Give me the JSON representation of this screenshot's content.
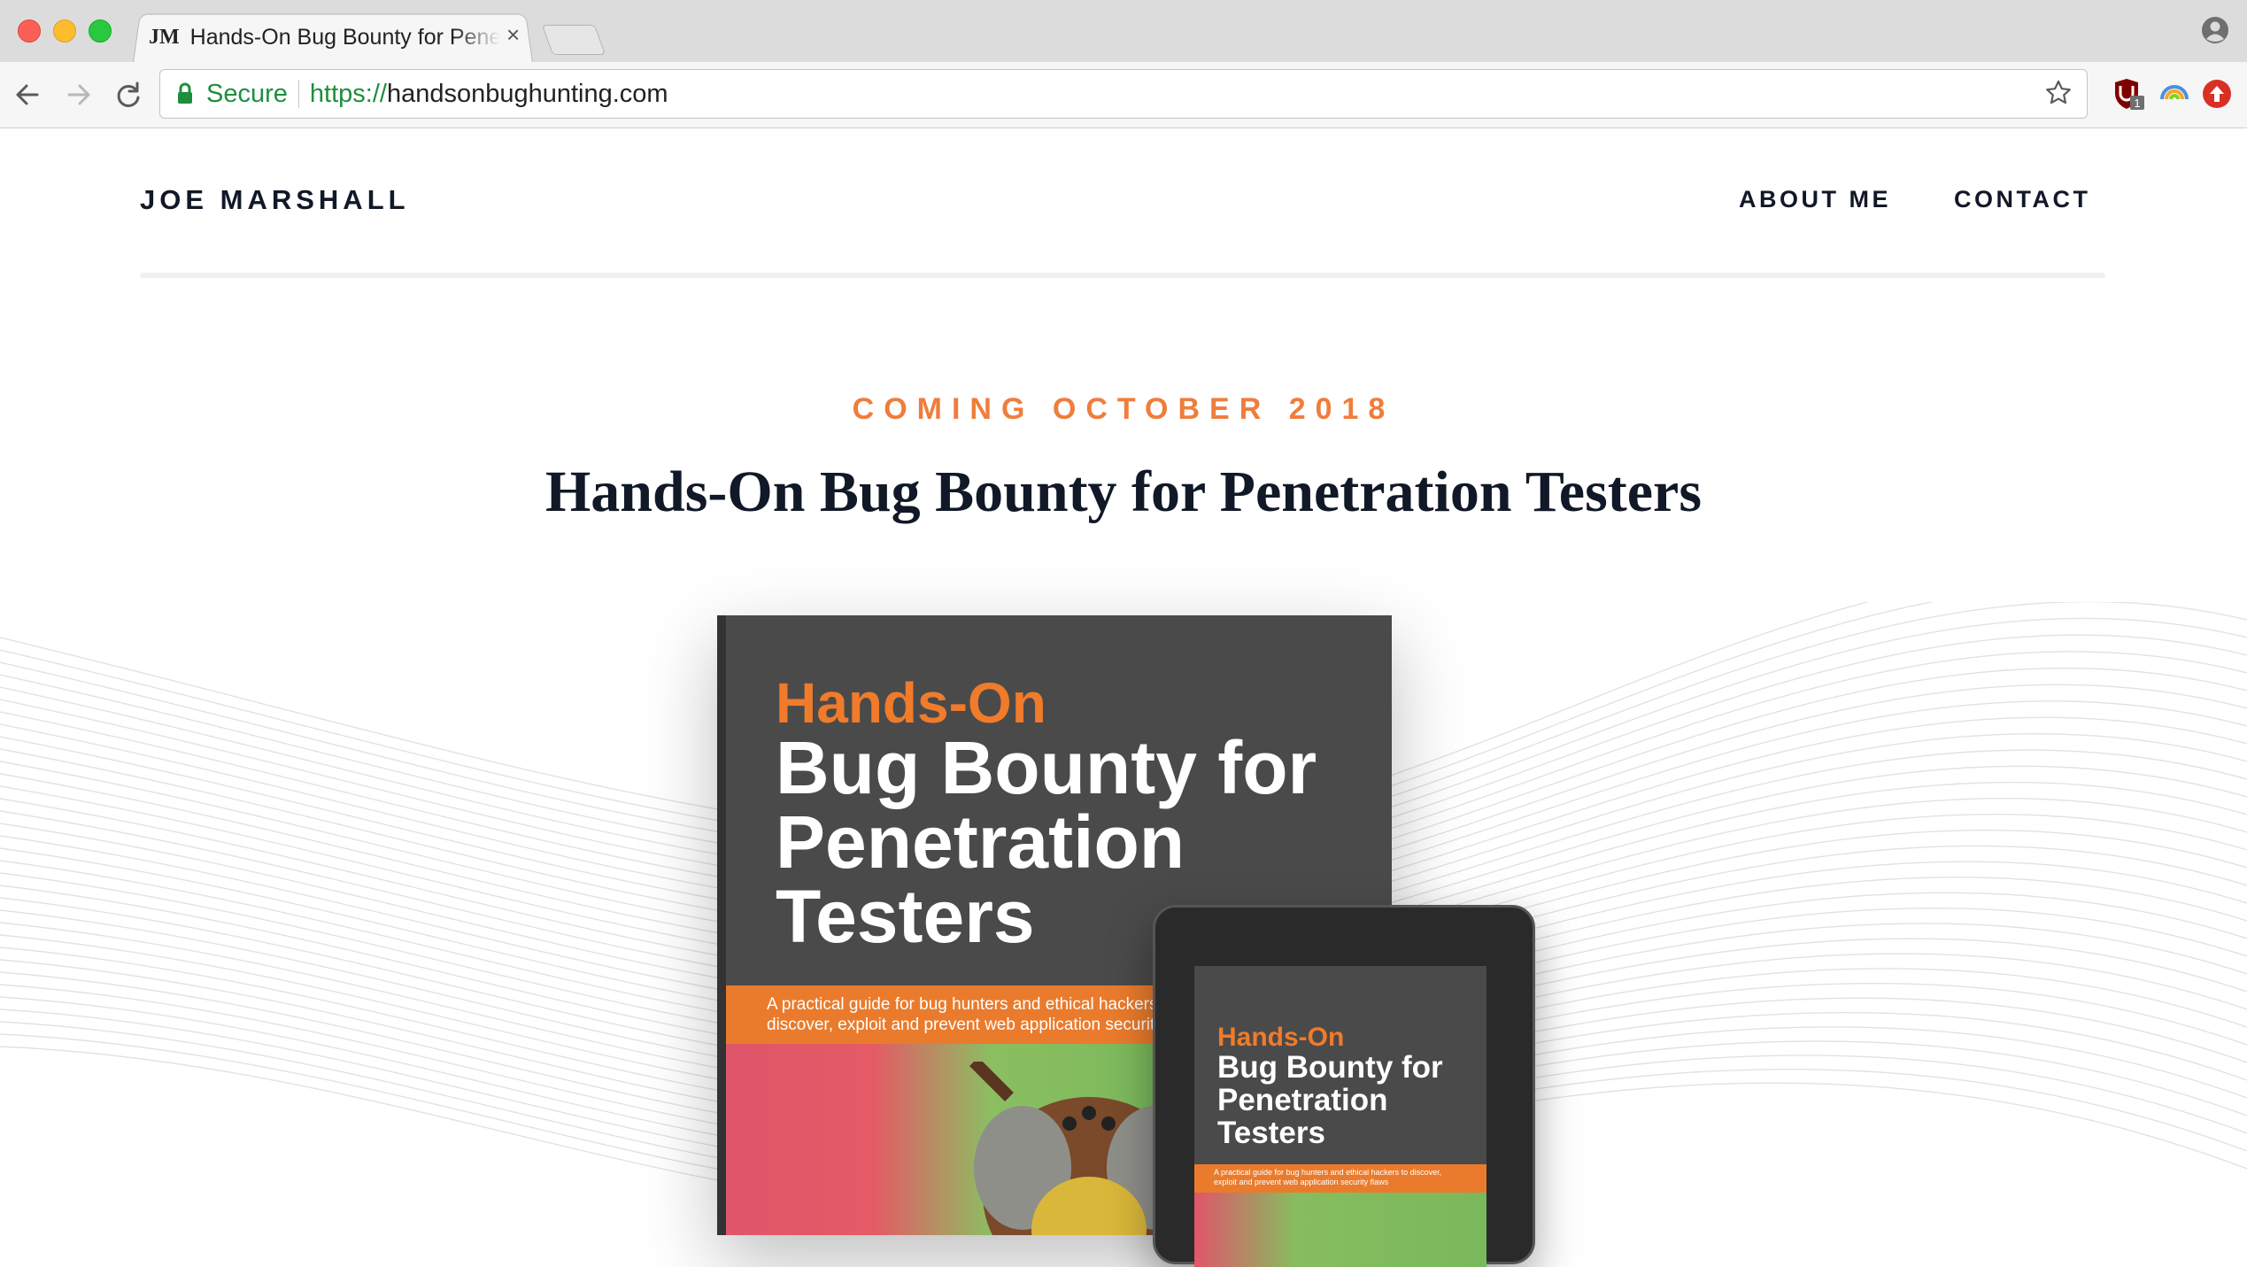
{
  "browser": {
    "tab": {
      "favicon_text": "JM",
      "title": "Hands-On Bug Bounty for Penetration Testers",
      "close_glyph": "×"
    },
    "omnibox": {
      "secure_label": "Secure",
      "url_scheme": "https://",
      "url_host": "handsonbughunting.com"
    },
    "extensions": {
      "badge_count": "1"
    }
  },
  "site": {
    "brand": "JOE MARSHALL",
    "nav": {
      "about": "ABOUT ME",
      "contact": "CONTACT"
    }
  },
  "hero": {
    "eyebrow": "COMING OCTOBER 2018",
    "title": "Hands-On Bug Bounty for Penetration Testers"
  },
  "book_cover": {
    "line1": "Hands-On",
    "line2": "Bug Bounty for Penetration Testers",
    "subtitle": "A practical guide for bug hunters and ethical hackers to discover, exploit and prevent web application security flaws"
  },
  "colors": {
    "accent_orange": "#ef7d3c",
    "heading_dark": "#111827",
    "secure_green": "#1e8e3e"
  }
}
